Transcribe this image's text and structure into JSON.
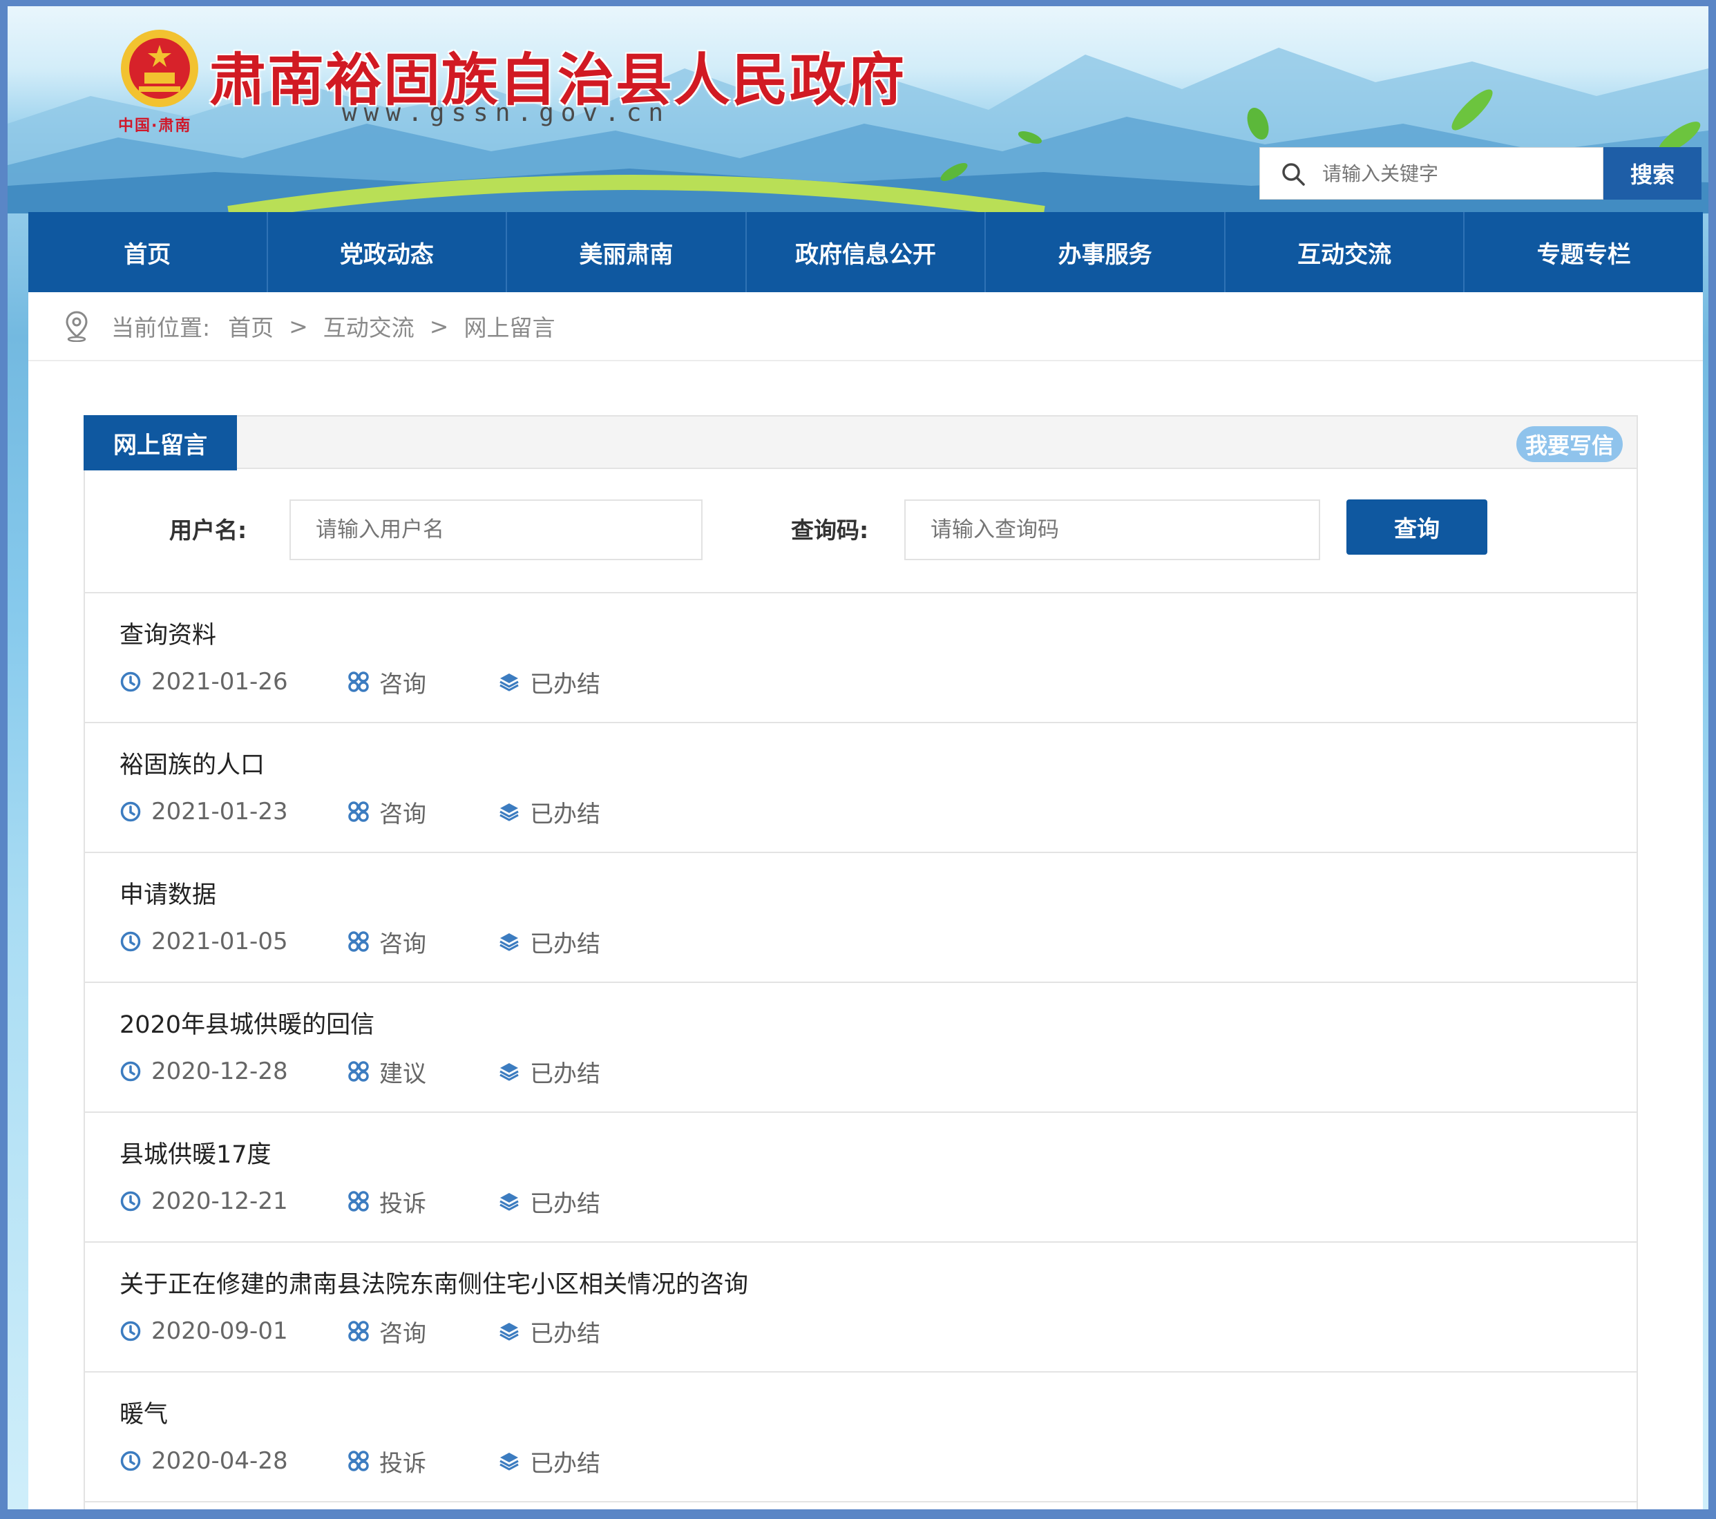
{
  "header": {
    "emblem_caption": "中国·肃南",
    "site_title": "肃南裕固族自治县人民政府",
    "site_url": "www.gssn.gov.cn"
  },
  "search": {
    "placeholder": "请输入关键字",
    "button_label": "搜索"
  },
  "nav": {
    "items": [
      "首页",
      "党政动态",
      "美丽肃南",
      "政府信息公开",
      "办事服务",
      "互动交流",
      "专题专栏"
    ]
  },
  "breadcrumb": {
    "prefix": "当前位置:",
    "items": [
      "首页",
      "互动交流",
      "网上留言"
    ],
    "separator": ">"
  },
  "panel": {
    "tab_label": "网上留言",
    "write_button": "我要写信"
  },
  "query": {
    "username_label": "用户名:",
    "username_placeholder": "请输入用户名",
    "code_label": "查询码:",
    "code_placeholder": "请输入查询码",
    "button_label": "查询"
  },
  "messages": [
    {
      "title": "查询资料",
      "date": "2021-01-26",
      "type": "咨询",
      "status": "已办结"
    },
    {
      "title": "裕固族的人口",
      "date": "2021-01-23",
      "type": "咨询",
      "status": "已办结"
    },
    {
      "title": "申请数据",
      "date": "2021-01-05",
      "type": "咨询",
      "status": "已办结"
    },
    {
      "title": "2020年县城供暖的回信",
      "date": "2020-12-28",
      "type": "建议",
      "status": "已办结"
    },
    {
      "title": "县城供暖17度",
      "date": "2020-12-21",
      "type": "投诉",
      "status": "已办结"
    },
    {
      "title": "关于正在修建的肃南县法院东南侧住宅小区相关情况的咨询",
      "date": "2020-09-01",
      "type": "咨询",
      "status": "已办结"
    },
    {
      "title": "暖气",
      "date": "2020-04-28",
      "type": "投诉",
      "status": "已办结"
    }
  ],
  "colors": {
    "primary": "#0f58a0",
    "title_red": "#d11a23",
    "icon_blue": "#3c7cc0",
    "write_button": "#8fc3ec"
  }
}
